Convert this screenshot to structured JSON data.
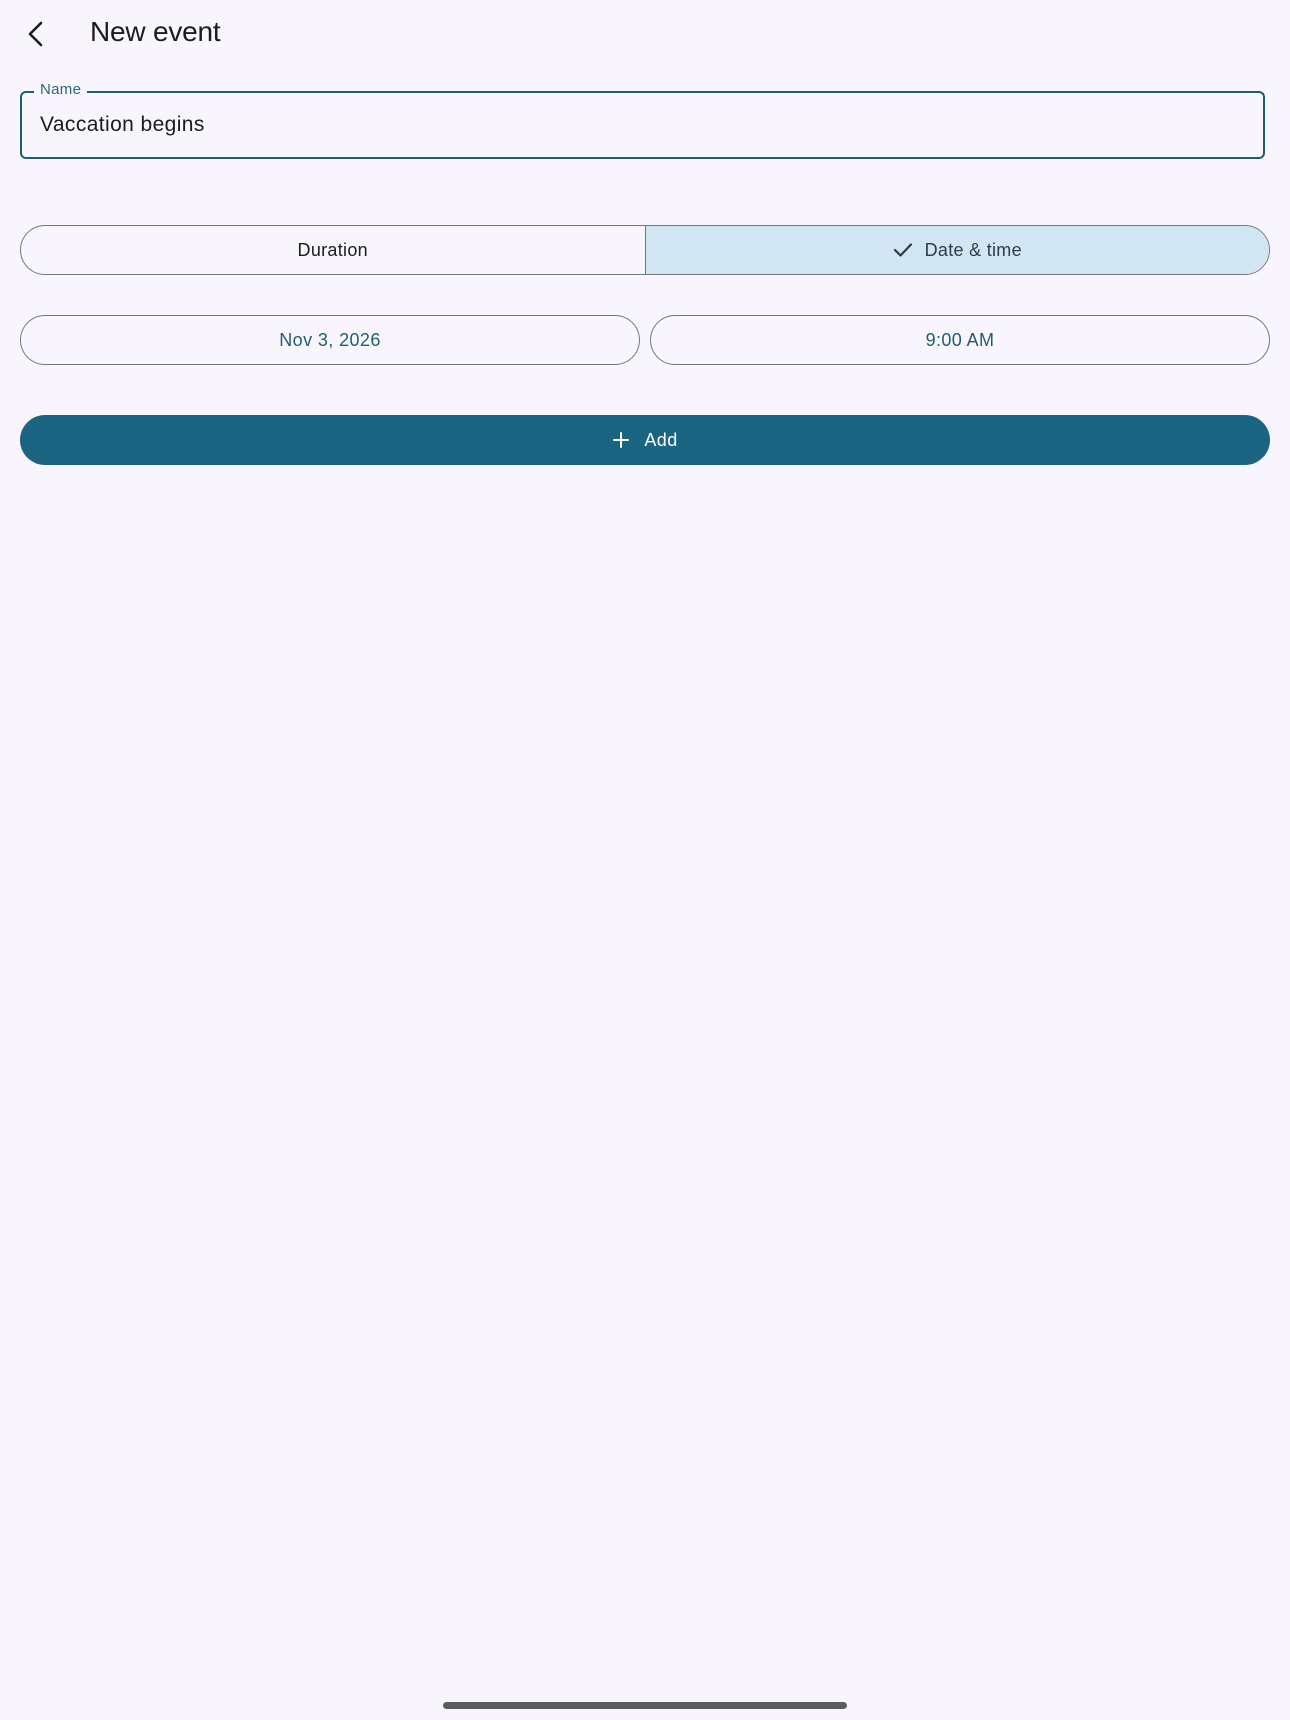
{
  "header": {
    "title": "New event",
    "back_icon": "back-arrow-icon"
  },
  "name_field": {
    "label": "Name",
    "value": "Vaccation begins"
  },
  "mode_toggle": {
    "options": [
      {
        "label": "Duration",
        "selected": false
      },
      {
        "label": "Date & time",
        "selected": true
      }
    ],
    "selected_icon": "check-icon",
    "selected_color": "#d1e5f2"
  },
  "date_button": {
    "label": "Nov 3, 2026"
  },
  "time_button": {
    "label": "9:00 AM"
  },
  "add_button": {
    "label": "Add",
    "icon": "plus-icon",
    "color": "#1b6583"
  },
  "colors": {
    "background": "#f8f6fc",
    "accent": "#1f5e6e"
  }
}
